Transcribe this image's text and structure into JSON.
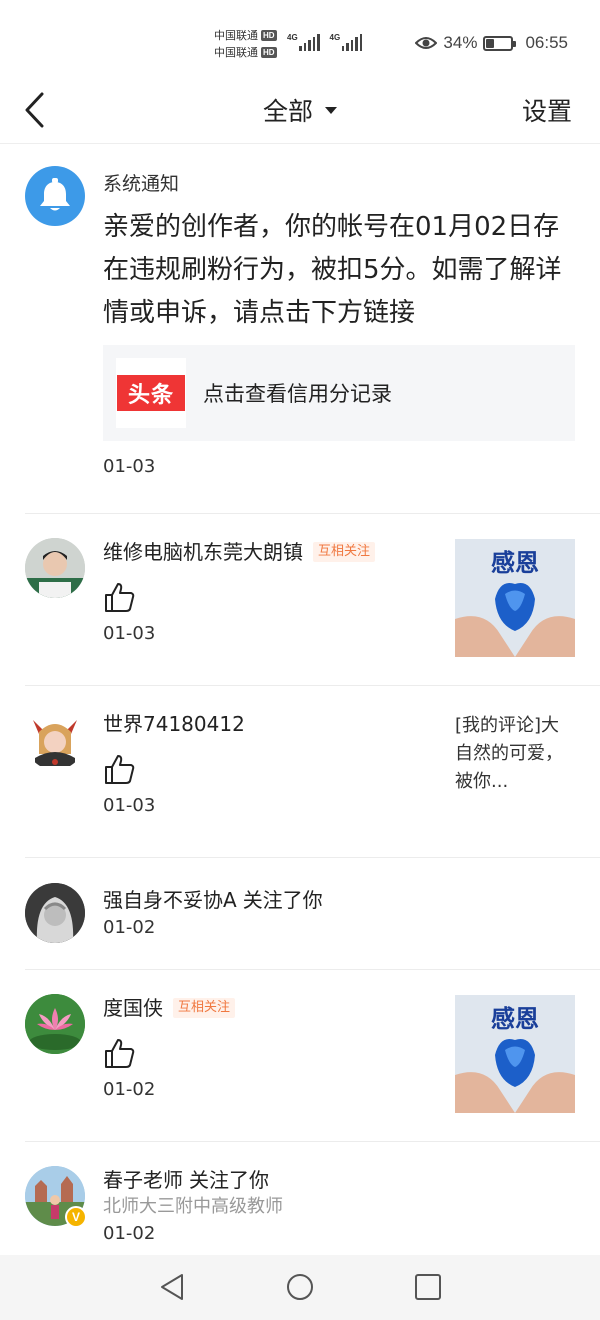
{
  "status_bar": {
    "carrier_1": "中国联通",
    "carrier_2": "中国联通",
    "hd_badge": "HD",
    "network_1": "4G",
    "network_2": "4G",
    "battery_percent": "34%",
    "time": "06:55",
    "battery_level": 0.34
  },
  "header": {
    "title": "全部",
    "settings_label": "设置"
  },
  "system_notice": {
    "sender": "系统通知",
    "body": "亲爱的创作者，你的帐号在01月02日存在违规刷粉行为，被扣5分。如需了解详情或申诉，请点击下方链接",
    "logo_text": "头条",
    "link_text": "点击查看信用分记录",
    "date": "01-03"
  },
  "notifications": [
    {
      "name": "维修电脑机东莞大朗镇",
      "tag": "互相关注",
      "date": "01-03",
      "thumb_text": "感恩"
    },
    {
      "name": "世界74180412",
      "date": "01-03",
      "comment_quote": "[我的评论]大自然的可爱，被你..."
    },
    {
      "name": "强自身不妥协A",
      "action": "关注了你",
      "date": "01-02"
    },
    {
      "name": "度国侠",
      "tag": "互相关注",
      "date": "01-02",
      "thumb_text": "感恩"
    },
    {
      "name": "春子老师",
      "action": "关注了你",
      "subtitle": "北师大三附中高级教师",
      "date": "01-02",
      "badge": "V"
    }
  ]
}
